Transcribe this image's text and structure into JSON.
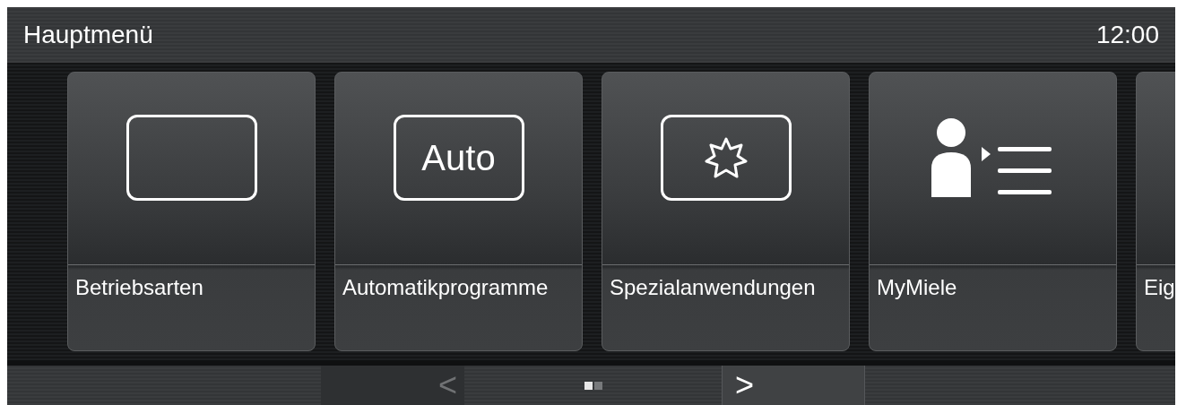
{
  "header": {
    "title": "Hauptmenü",
    "time": "12:00"
  },
  "tiles": [
    {
      "label": "Betriebsarten",
      "kind": "frame"
    },
    {
      "label": "Automatikprogramme",
      "kind": "auto",
      "icon_text": "Auto"
    },
    {
      "label": "Spezialanwendungen",
      "kind": "star"
    },
    {
      "label": "MyMiele",
      "kind": "person"
    },
    {
      "label": "Eig",
      "kind": "partial"
    }
  ],
  "pager": {
    "prev": {
      "label": "<",
      "disabled": true
    },
    "next": {
      "label": ">",
      "disabled": false
    },
    "pages": [
      {
        "selected": true
      },
      {
        "selected": false
      }
    ]
  }
}
